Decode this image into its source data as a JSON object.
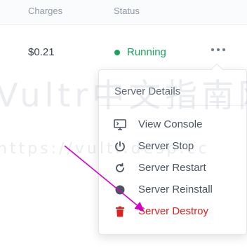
{
  "table": {
    "headers": {
      "charges": "Charges",
      "status": "Status"
    }
  },
  "row": {
    "charges": "$0.21",
    "status": "Running"
  },
  "menu": {
    "title": "Server Details",
    "items": [
      {
        "label": "View Console",
        "icon": "monitor-icon"
      },
      {
        "label": "Server Stop",
        "icon": "power-icon"
      },
      {
        "label": "Server Restart",
        "icon": "restart-icon"
      },
      {
        "label": "Server Reinstall",
        "icon": "reinstall-icon"
      },
      {
        "label": "Server Destroy",
        "icon": "trash-icon"
      }
    ]
  },
  "watermark": {
    "line1": "Vultr中文指南网",
    "line2": "https://vultr.desp.cc"
  },
  "colors": {
    "running": "#1aa35a",
    "danger": "#e02020",
    "annotation_arrow": "#d400c8"
  }
}
